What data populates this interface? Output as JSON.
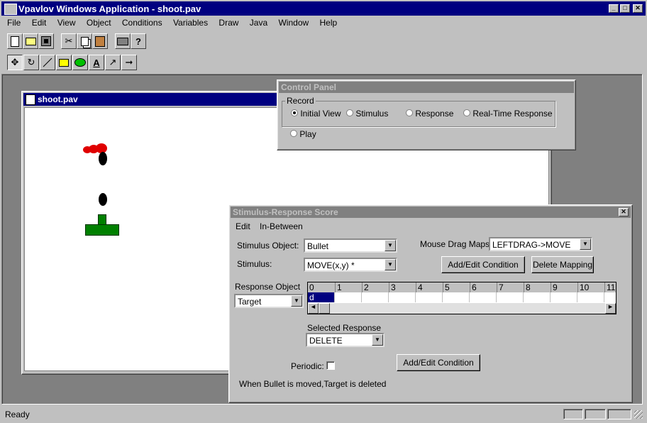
{
  "app": {
    "title": "Vpavlov Windows Application - shoot.pav",
    "menu": [
      "File",
      "Edit",
      "View",
      "Object",
      "Conditions",
      "Variables",
      "Draw",
      "Java",
      "Window",
      "Help"
    ],
    "status": "Ready"
  },
  "toolbar1": [
    "new-icon",
    "open-icon",
    "save-icon",
    "cut-icon",
    "copy-icon",
    "paste-icon",
    "print-icon",
    "help-icon"
  ],
  "toolbar2": [
    "move-tool-icon",
    "rotate-tool-icon",
    "line-tool-icon",
    "rectangle-tool-icon",
    "ellipse-tool-icon",
    "text-tool-icon",
    "drag-tool-icon",
    "arrow-tool-icon"
  ],
  "doc": {
    "title": "shoot.pav"
  },
  "control_panel": {
    "title": "Control Panel",
    "group_label": "Record",
    "options": [
      "Initial View",
      "Stimulus",
      "Response",
      "Real-Time Response"
    ],
    "selected": "Initial View",
    "play_label": "Play"
  },
  "sr": {
    "title": "Stimulus-Response Score",
    "close": "✕",
    "menu": [
      "Edit",
      "In-Between"
    ],
    "stimulus_object_label": "Stimulus Object:",
    "stimulus_object_value": "Bullet",
    "stimulus_label": "Stimulus:",
    "stimulus_value": "MOVE(x,y) *",
    "mouse_drag_label": "Mouse Drag Maps:",
    "mouse_drag_value": "LEFTDRAG->MOVE",
    "add_edit_condition_1": "Add/Edit Condition",
    "delete_mapping": "Delete Mapping",
    "response_object_label": "Response Object",
    "response_object_value": "Target",
    "timeline_ticks": [
      "0",
      "1",
      "2",
      "3",
      "4",
      "5",
      "6",
      "7",
      "8",
      "9",
      "10",
      "11"
    ],
    "timeline_cell": "d",
    "selected_response_label": "Selected Response",
    "selected_response_value": "DELETE",
    "periodic_label": "Periodic:",
    "add_edit_condition_2": "Add/Edit Condition",
    "summary": "When Bullet is moved,Target is deleted"
  }
}
